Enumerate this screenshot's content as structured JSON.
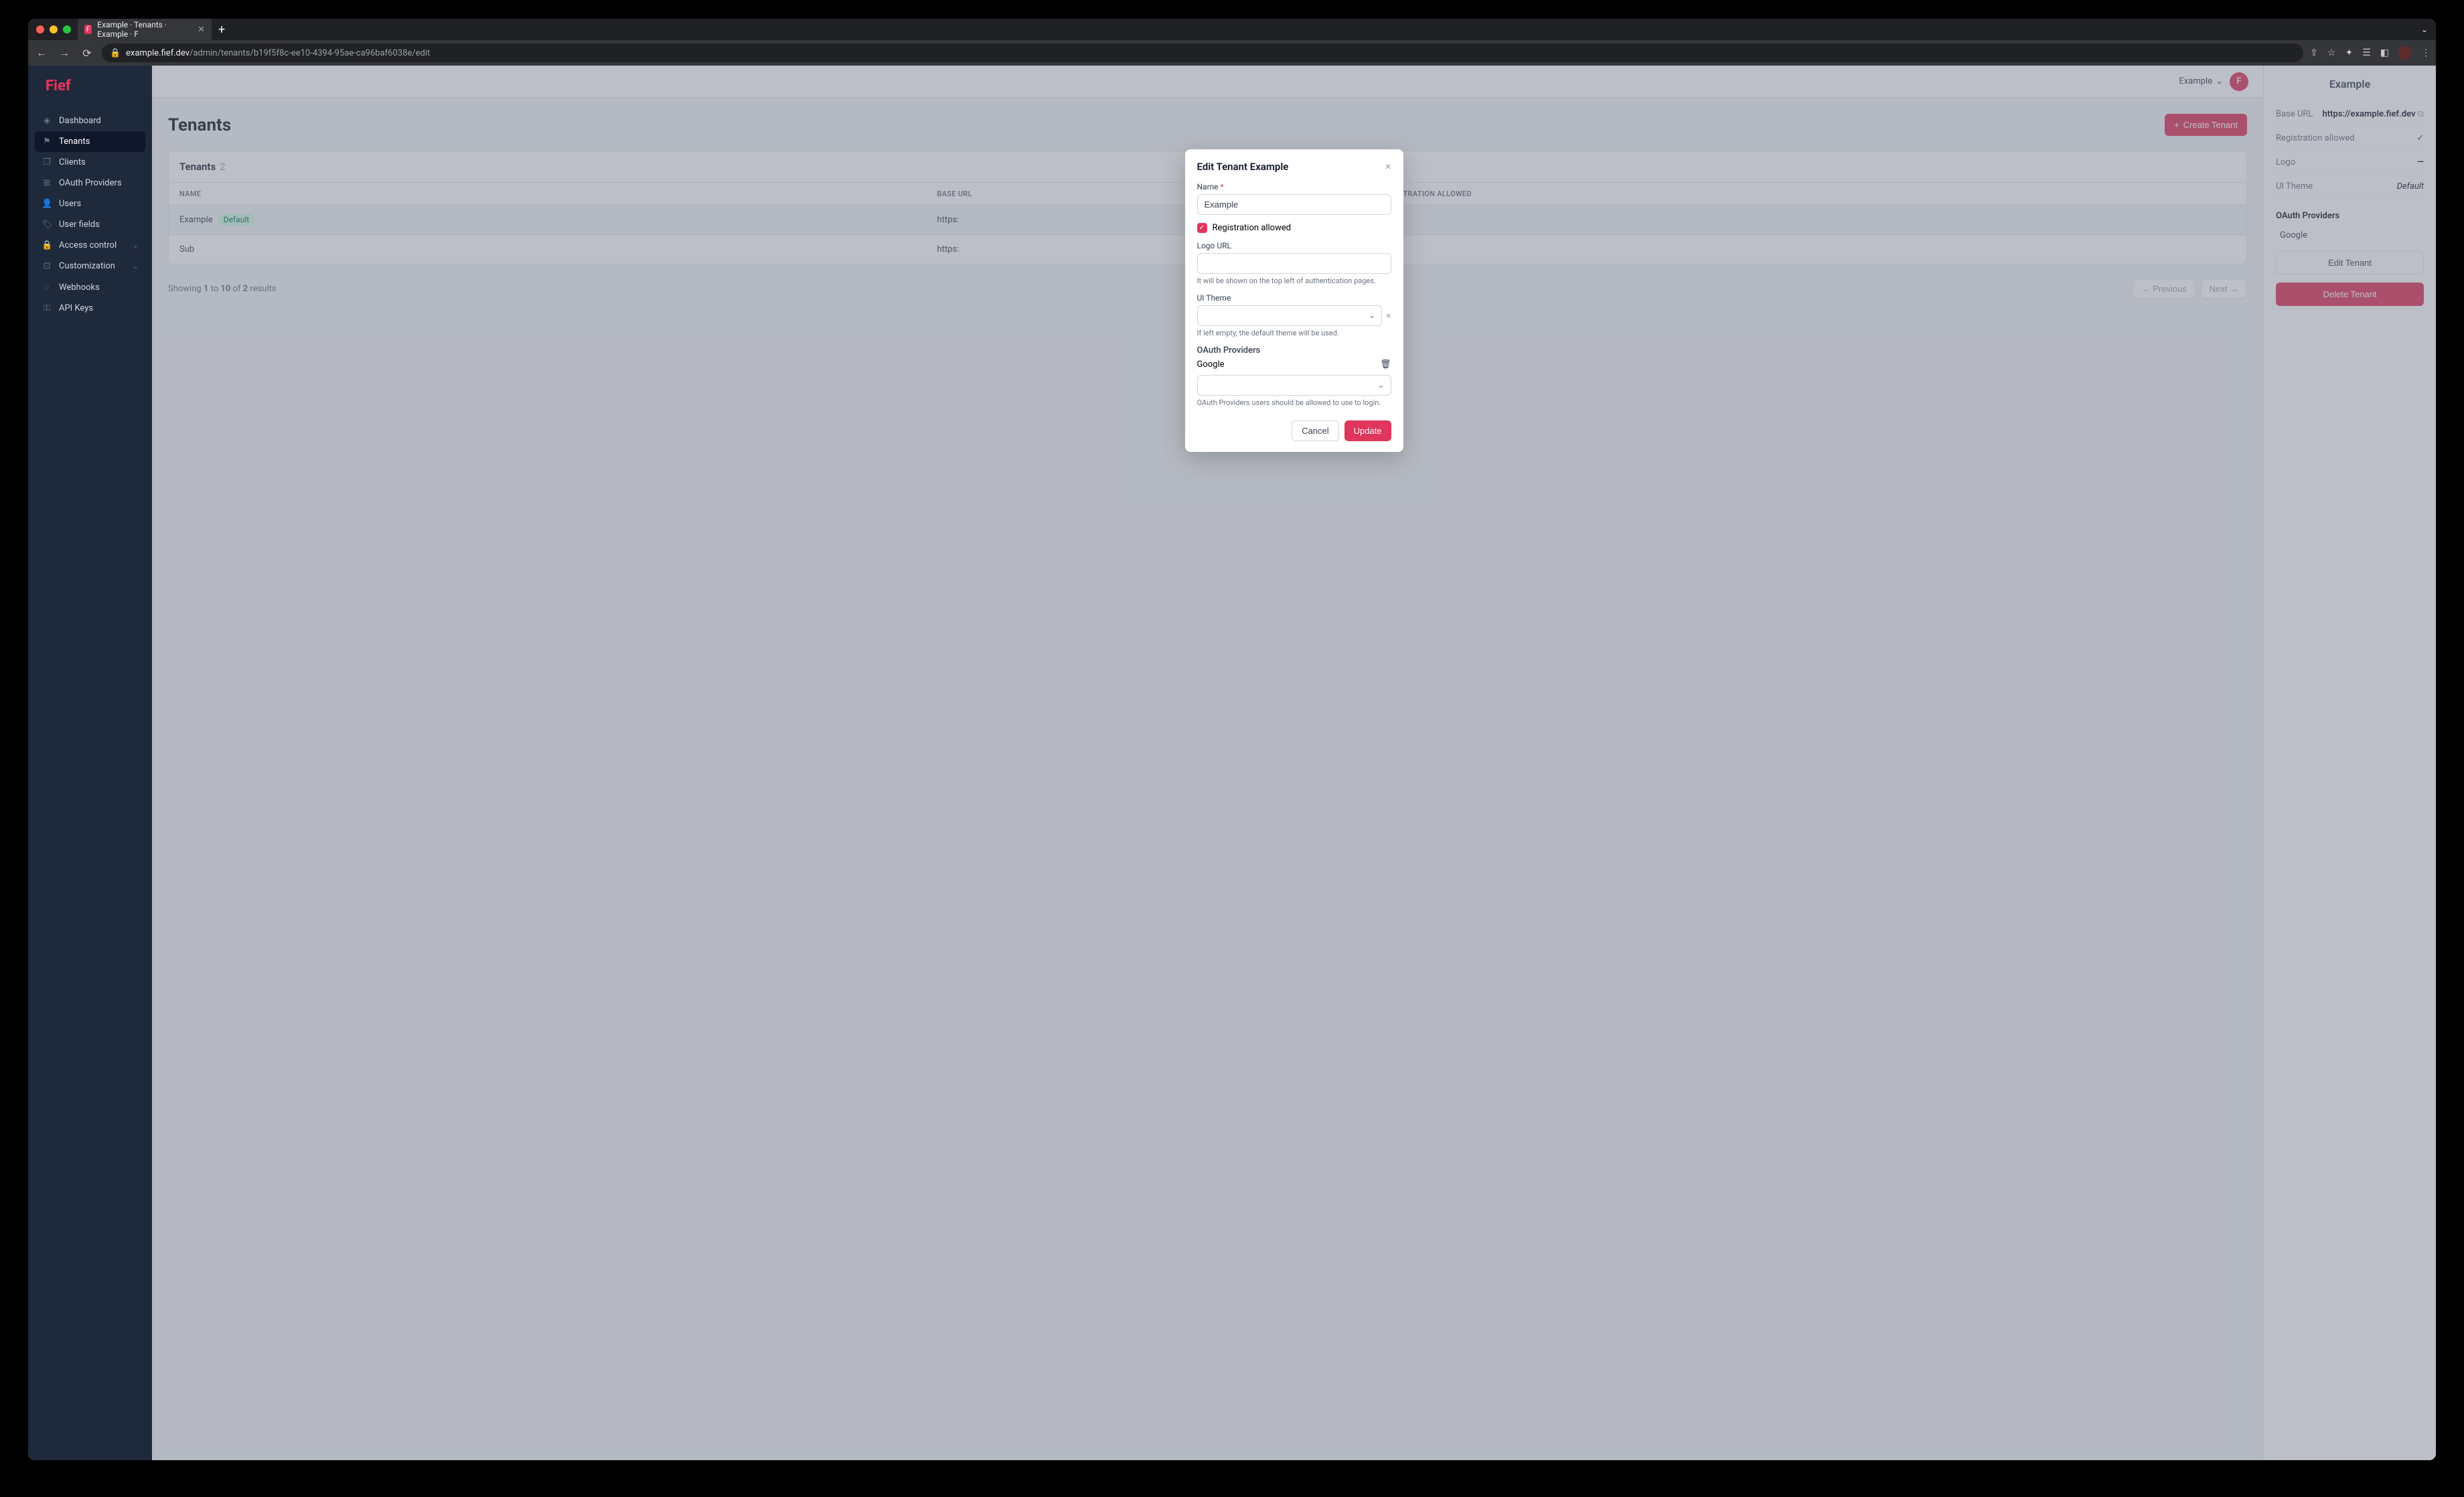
{
  "browser": {
    "tab_title": "Example · Tenants · Example · F",
    "url_host": "example.fief.dev",
    "url_path": "/admin/tenants/b19f5f8c-ee10-4394-95ae-ca96baf6038e/edit"
  },
  "brand": "Fief",
  "nav": {
    "items": [
      {
        "label": "Dashboard",
        "icon": "◈"
      },
      {
        "label": "Tenants",
        "icon": "⚑",
        "active": true
      },
      {
        "label": "Clients",
        "icon": "❐"
      },
      {
        "label": "OAuth Providers",
        "icon": "⊞"
      },
      {
        "label": "Users",
        "icon": "👤"
      },
      {
        "label": "User fields",
        "icon": "🏷"
      },
      {
        "label": "Access control",
        "icon": "🔒",
        "expandable": true
      },
      {
        "label": "Customization",
        "icon": "⊡",
        "expandable": true
      },
      {
        "label": "Webhooks",
        "icon": "◌"
      },
      {
        "label": "API Keys",
        "icon": "⚿"
      }
    ]
  },
  "topbar": {
    "tenant": "Example",
    "avatar_initial": "F"
  },
  "page": {
    "title": "Tenants",
    "create_label": "Create Tenant",
    "card_title": "Tenants",
    "count": "2",
    "columns": [
      "NAME",
      "BASE URL",
      "REGISTRATION ALLOWED"
    ],
    "rows": [
      {
        "name": "Example",
        "default": true,
        "base": "https:",
        "reg": ""
      },
      {
        "name": "Sub",
        "default": false,
        "base": "https:",
        "reg": ""
      }
    ],
    "default_badge": "Default",
    "results_text": {
      "pre": "Showing ",
      "s": "1",
      "mid": " to ",
      "e": "10",
      "of": " of ",
      "t": "2",
      "suf": " results"
    },
    "prev": "← Previous",
    "next": "Next →"
  },
  "side": {
    "title": "Example",
    "rows": [
      {
        "label": "Base URL",
        "value": "https://example.fief.dev",
        "copy": true
      },
      {
        "label": "Registration allowed",
        "value": "",
        "check": true
      },
      {
        "label": "Logo",
        "value": "—"
      },
      {
        "label": "UI Theme",
        "value": "Default",
        "italic": true
      }
    ],
    "oauth_title": "OAuth Providers",
    "oauth_items": [
      "Google"
    ],
    "edit": "Edit Tenant",
    "delete": "Delete Tenant"
  },
  "modal": {
    "title": "Edit Tenant Example",
    "name_label": "Name",
    "name_value": "Example",
    "reg_label": "Registration allowed",
    "logo_label": "Logo URL",
    "logo_help": "It will be shown on the top left of authentication pages.",
    "theme_label": "UI Theme",
    "theme_help": "If left empty, the default theme will be used.",
    "oauth_label": "OAuth Providers",
    "oauth_item": "Google",
    "oauth_help": "OAuth Providers users should be allowed to use to login.",
    "cancel": "Cancel",
    "update": "Update"
  }
}
